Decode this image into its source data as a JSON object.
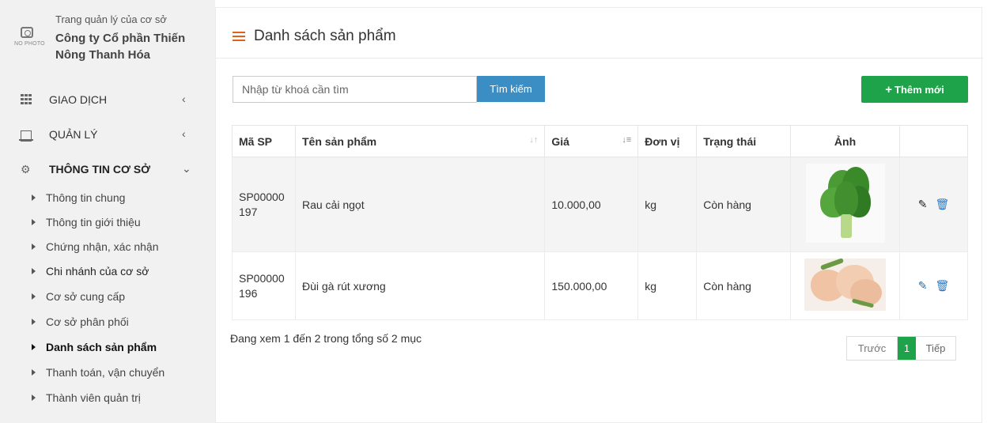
{
  "sidebar": {
    "org_subtitle": "Trang quản lý của cơ sở",
    "org_name": "Công ty Cổ phần Thiến Nông Thanh Hóa",
    "no_photo_label": "NO PHOTO",
    "menu": [
      {
        "label": "GIAO DỊCH",
        "icon": "grid-icon",
        "arrow": "‹"
      },
      {
        "label": "QUẢN LÝ",
        "icon": "laptop-icon",
        "arrow": "‹"
      },
      {
        "label": "THÔNG TIN CƠ SỞ",
        "icon": "gears-icon",
        "arrow": "⌄"
      }
    ],
    "sub_items": [
      "Thông tin chung",
      "Thông tin giới thiệu",
      "Chứng nhận, xác nhận",
      "Chi nhánh của cơ sở",
      "Cơ sở cung cấp",
      "Cơ sở phân phối",
      "Danh sách sản phẩm",
      "Thanh toán, vận chuyển",
      "Thành viên quản trị"
    ],
    "active_sub_item": "Danh sách sản phẩm"
  },
  "main": {
    "title": "Danh sách sản phẩm",
    "search": {
      "placeholder": "Nhập từ khoá cần tìm",
      "button_label": "Tìm kiếm"
    },
    "add_button_label": "Thêm mới",
    "table": {
      "headers": [
        "Mã SP",
        "Tên sản phẩm",
        "Giá",
        "Đơn vị",
        "Trạng thái",
        "Ảnh",
        ""
      ],
      "rows": [
        {
          "code": "SP00000 197",
          "name": "Rau cải ngọt",
          "price": "10.000,00",
          "unit": "kg",
          "status": "Còn hàng",
          "image": "leafy-greens"
        },
        {
          "code": "SP00000 196",
          "name": "Đùi gà rút xương",
          "price": "150.000,00",
          "unit": "kg",
          "status": "Còn hàng",
          "image": "chicken-thighs"
        }
      ]
    },
    "info_text": "Đang xem 1 đến 2 trong tổng số 2 mục",
    "pagination": {
      "prev": "Trước",
      "current": "1",
      "next": "Tiếp"
    }
  },
  "colors": {
    "accent_orange": "#e0611c",
    "search_blue": "#3a8ec4",
    "add_green": "#1fa34a"
  }
}
